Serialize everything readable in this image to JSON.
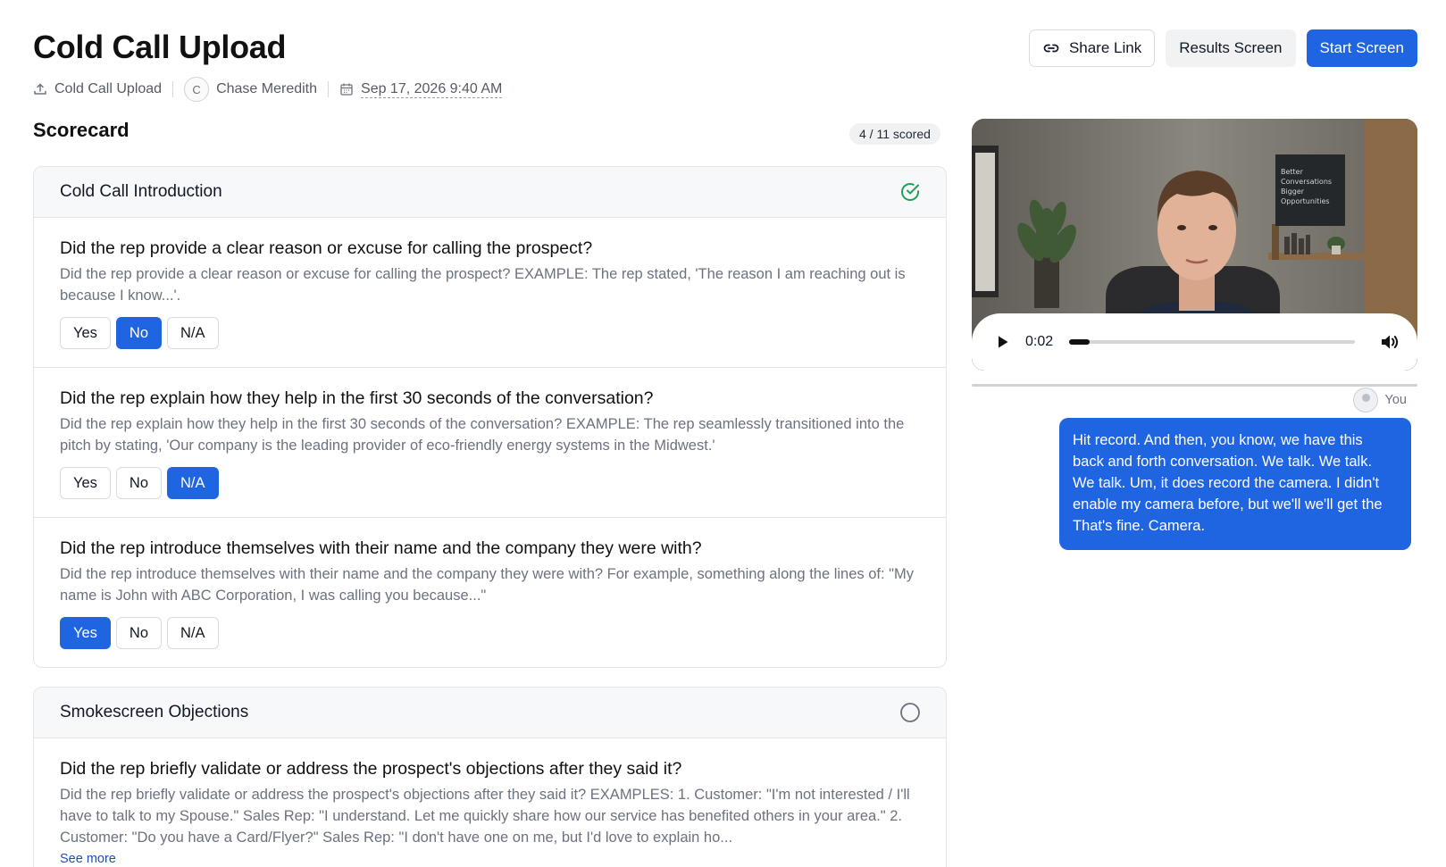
{
  "header": {
    "title": "Cold Call Upload",
    "breadcrumb_upload": "Cold Call Upload",
    "user_initial": "C",
    "user_name": "Chase Meredith",
    "date": "Sep 17, 2026 9:40 AM",
    "share_label": "Share Link",
    "results_label": "Results Screen",
    "start_label": "Start Screen"
  },
  "icons": {
    "upload": "upload-icon",
    "calendar": "calendar-icon",
    "link": "link-icon",
    "check_circle": "check-circle-icon",
    "empty_circle": "empty-circle-icon",
    "play": "play-icon",
    "volume": "volume-icon"
  },
  "colors": {
    "primary": "#1f64e0",
    "success": "#22a05a"
  },
  "scorecard": {
    "title": "Scorecard",
    "scored": "4 / 11 scored",
    "sections": [
      {
        "title": "Cold Call Introduction",
        "status": "complete",
        "questions": [
          {
            "title": "Did the rep provide a clear reason or excuse for calling the prospect?",
            "description": "Did the rep provide a clear reason or excuse for calling the prospect? EXAMPLE: The rep stated, 'The reason I am reaching out is because I know...'.",
            "selected": "No"
          },
          {
            "title": "Did the rep explain how they help in the first 30 seconds of the conversation?",
            "description": "Did the rep explain how they help in the first 30 seconds of the conversation? EXAMPLE: The rep seamlessly transitioned into the pitch by stating, 'Our company is the leading provider of eco-friendly energy systems in the Midwest.'",
            "selected": "N/A"
          },
          {
            "title": "Did the rep introduce themselves with their name and the company they were with?",
            "description": "Did the rep introduce themselves with their name and the company they were with? For example, something along the lines of: \"My name is John with ABC Corporation, I was calling you because...\"",
            "selected": "Yes"
          }
        ]
      },
      {
        "title": "Smokescreen Objections",
        "status": "incomplete",
        "questions": [
          {
            "title": "Did the rep briefly validate or address the prospect's objections after they said it?",
            "description": "Did the rep briefly validate or address the prospect's objections after they said it? EXAMPLES: 1. Customer: \"I'm not interested / I'll have to talk to my Spouse.\" Sales Rep: \"I understand. Let me quickly share how our service has benefited others in your area.\" 2. Customer: \"Do you have a Card/Flyer?\" Sales Rep: \"I don't have one on me, but I'd love to explain ho...",
            "see_more": "See more"
          }
        ]
      }
    ],
    "answer_labels": {
      "yes": "Yes",
      "no": "No",
      "na": "N/A"
    }
  },
  "video": {
    "time": "0:02",
    "progress": 0.07,
    "poster_text": "Better Conversations Bigger Opportunities"
  },
  "chat": {
    "speaker": "You",
    "message": "Hit record. And then, you know, we have this back and forth conversation. We talk. We talk. We talk. Um, it does record the camera. I didn't enable my camera before, but we'll we'll get the That's fine. Camera."
  }
}
